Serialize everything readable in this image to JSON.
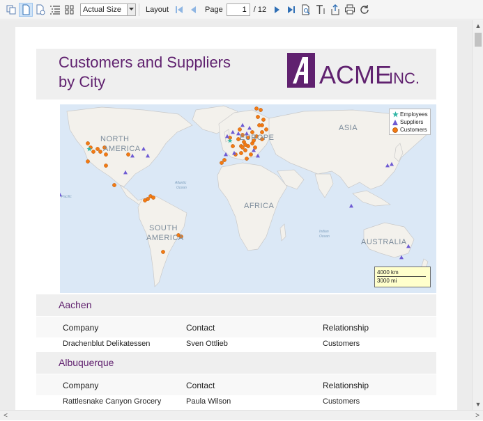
{
  "toolbar": {
    "zoom_value": "Actual Size",
    "layout_label": "Layout",
    "page_label": "Page",
    "page_current": "1",
    "page_total": "/ 12"
  },
  "report": {
    "title_line1": "Customers and Suppliers",
    "title_line2": "by City",
    "logo_text": "ACME",
    "logo_suffix": "INC."
  },
  "map": {
    "labels": {
      "north_america": "NORTH",
      "north_america2": "AMERICA",
      "europe": "EUROPE",
      "asia": "ASIA",
      "africa": "AFRICA",
      "south_america": "SOUTH",
      "south_america2": "AMERICA",
      "australia": "AUSTRALIA",
      "atlantic": "Atlantic",
      "atlantic2": "Ocean",
      "indian": "Indian",
      "indian2": "Ocean",
      "pacific": "Pacific"
    },
    "legend": [
      {
        "label": "Employees",
        "symbol": "star",
        "color": "#2fb5a5"
      },
      {
        "label": "Suppliers",
        "symbol": "triangle",
        "color": "#6e5bd3"
      },
      {
        "label": "Customers",
        "symbol": "circle",
        "color": "#f47a12"
      }
    ],
    "scale_km": "4000 km",
    "scale_mi": "3000 mi"
  },
  "groups": [
    {
      "city": "Aachen",
      "headers": {
        "company": "Company",
        "contact": "Contact",
        "relationship": "Relationship"
      },
      "rows": [
        {
          "company": "Drachenblut Delikatessen",
          "contact": "Sven Ottlieb",
          "relationship": "Customers"
        }
      ]
    },
    {
      "city": "Albuquerque",
      "headers": {
        "company": "Company",
        "contact": "Contact",
        "relationship": "Relationship"
      },
      "rows": [
        {
          "company": "Rattlesnake Canyon Grocery",
          "contact": "Paula Wilson",
          "relationship": "Customers"
        }
      ]
    }
  ],
  "colors": {
    "accent": "#60216f",
    "customer": "#f47a12",
    "supplier": "#6e5bd3",
    "employee": "#2fb5a5"
  }
}
